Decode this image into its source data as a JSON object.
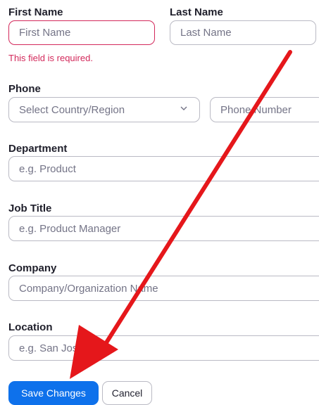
{
  "form": {
    "first_name": {
      "label": "First Name",
      "placeholder": "First Name",
      "error": "This field is required."
    },
    "last_name": {
      "label": "Last Name",
      "placeholder": "Last Name"
    },
    "phone": {
      "label": "Phone",
      "country_placeholder": "Select Country/Region",
      "number_placeholder": "Phone Number"
    },
    "department": {
      "label": "Department",
      "placeholder": "e.g. Product"
    },
    "job_title": {
      "label": "Job Title",
      "placeholder": "e.g. Product Manager"
    },
    "company": {
      "label": "Company",
      "placeholder": "Company/Organization Name"
    },
    "location": {
      "label": "Location",
      "placeholder": "e.g. San Jose"
    }
  },
  "actions": {
    "save_label": "Save Changes",
    "cancel_label": "Cancel"
  },
  "colors": {
    "error": "#d3295b",
    "primary": "#0e71eb",
    "annotation_arrow": "#e5171b"
  },
  "icons": {
    "country_dropdown": "chevron-down-icon",
    "annotation": "red-arrow-annotation"
  }
}
